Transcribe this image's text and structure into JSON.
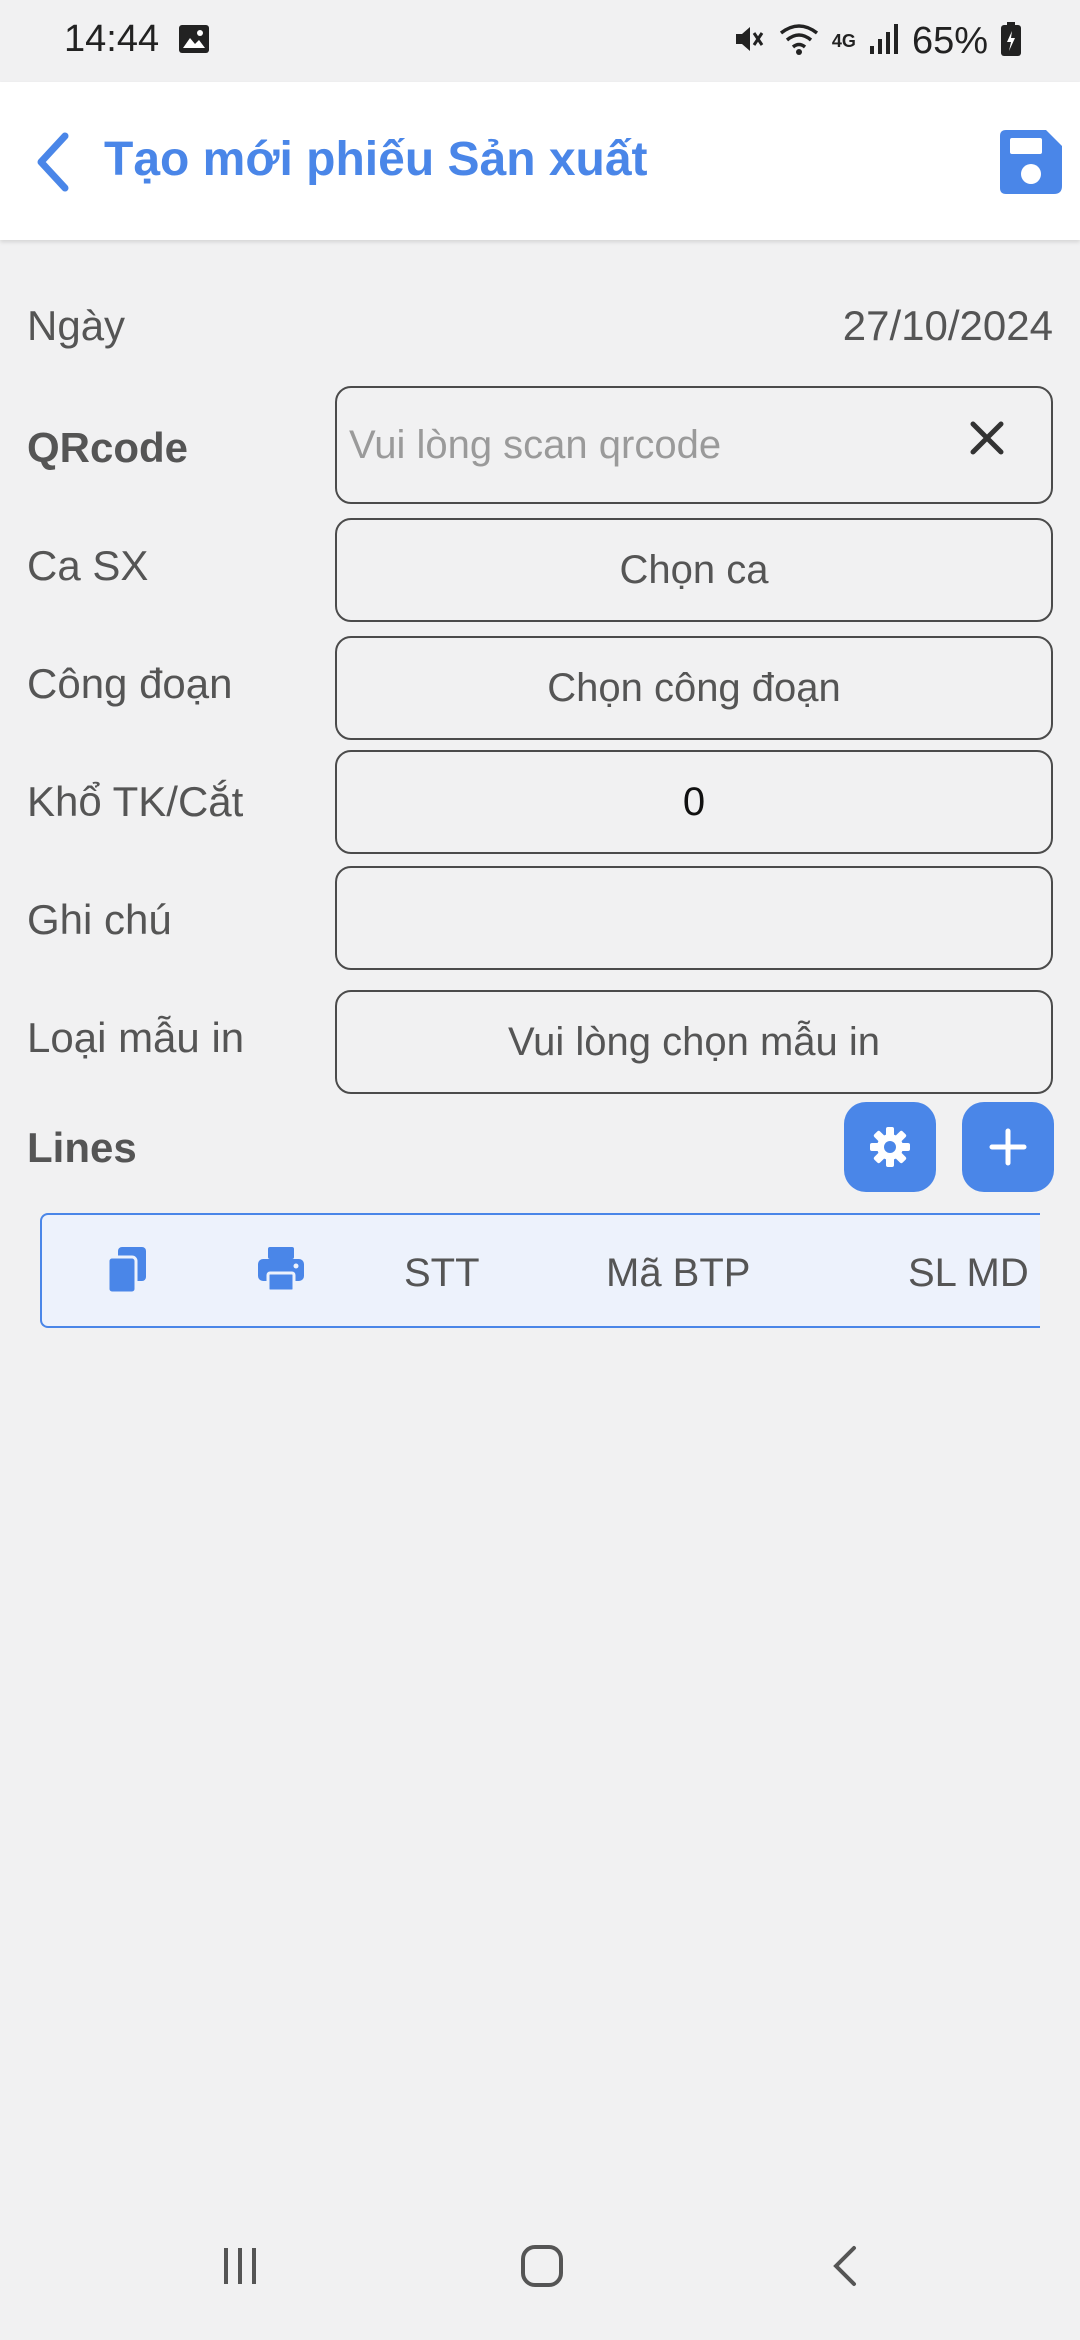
{
  "status": {
    "time": "14:44",
    "battery": "65%",
    "network": "4G"
  },
  "header": {
    "title": "Tạo mới phiếu Sản xuất"
  },
  "form": {
    "date_label": "Ngày",
    "date_value": "27/10/2024",
    "qrcode_label": "QRcode",
    "qrcode_placeholder": "Vui lòng scan qrcode",
    "shift_label": "Ca SX",
    "shift_value": "Chọn ca",
    "stage_label": "Công đoạn",
    "stage_value": "Chọn công đoạn",
    "size_label": "Khổ TK/Cắt",
    "size_value": "0",
    "note_label": "Ghi chú",
    "note_value": "",
    "print_label": "Loại mẫu in",
    "print_value": "Vui lòng chọn mẫu in"
  },
  "lines": {
    "title": "Lines",
    "columns": [
      "STT",
      "Mã BTP",
      "SL MD"
    ]
  },
  "colors": {
    "accent": "#4a86e8",
    "background": "#f1f1f2"
  }
}
